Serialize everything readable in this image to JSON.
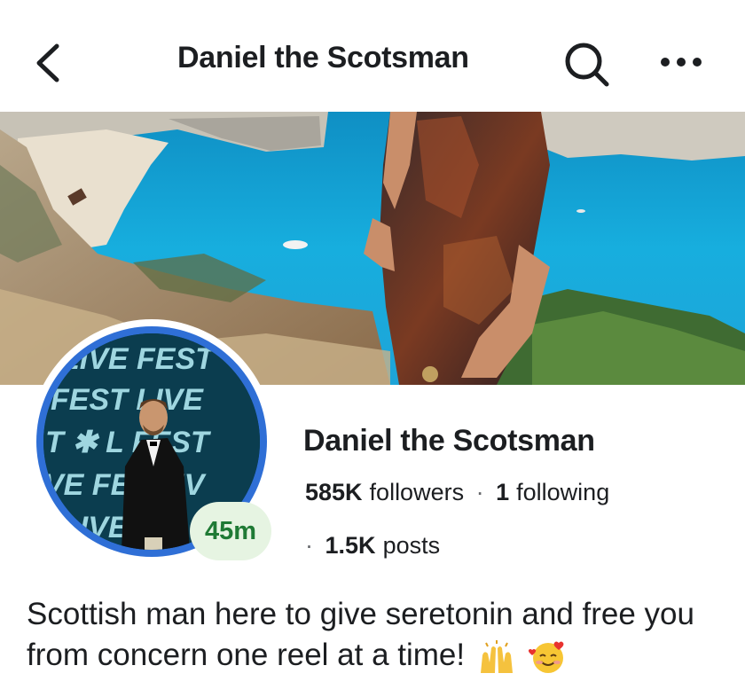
{
  "header": {
    "title": "Daniel the Scotsman"
  },
  "icons": {
    "back": "chevron-left-icon",
    "search": "search-icon",
    "more": "more-horizontal-icon"
  },
  "profile": {
    "name": "Daniel the Scotsman",
    "status_badge": "45m",
    "followers_count": "585K",
    "followers_label": "followers",
    "following_count": "1",
    "following_label": "following",
    "posts_count": "1.5K",
    "posts_label": "posts",
    "bio": "Scottish man here to give seretonin and free you from concern one reel at a time!"
  },
  "avatar_text": [
    "LIVE FEST",
    "FEST LIVE",
    "T ✱ L FEST",
    "VE FE : LIV",
    "LIVE"
  ],
  "colors": {
    "ring": "#2f6fd6",
    "badge_bg": "#e6f4e2",
    "badge_text": "#1f7a35",
    "sea": "#1aa7d6"
  }
}
